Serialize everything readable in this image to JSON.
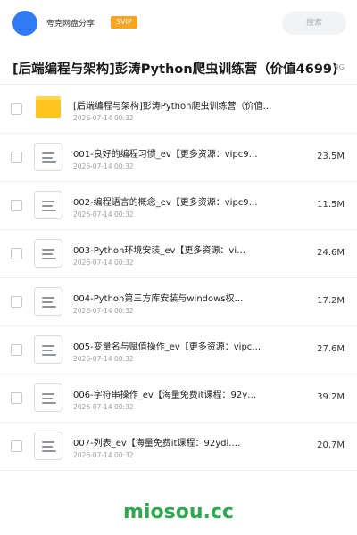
{
  "header": {
    "app_name": "夸克网盘分享",
    "badge": "SVIP",
    "search_placeholder": "搜索"
  },
  "folder": {
    "title": "[后端编程与架构]彭涛Python爬虫训练营（价值4699)",
    "total_size": "9G"
  },
  "files": [
    {
      "name": "[后端编程与架构]彭涛Python爬虫训练营（价值…",
      "date": "2026-07-14 00:32",
      "size": "",
      "type": "folder"
    },
    {
      "name": "001-良好的编程习惯_ev【更多资源：vipc9…",
      "date": "2026-07-14 00:32",
      "size": "23.5M",
      "type": "file"
    },
    {
      "name": "002-编程语言的概念_ev【更多资源：vipc9…",
      "date": "2026-07-14 00:32",
      "size": "11.5M",
      "type": "file"
    },
    {
      "name": "003-Python环境安装_ev【更多资源：vi…",
      "date": "2026-07-14 00:32",
      "size": "24.6M",
      "type": "file"
    },
    {
      "name": "004-Python第三方库安装与windows权…",
      "date": "2026-07-14 00:32",
      "size": "17.2M",
      "type": "file"
    },
    {
      "name": "005-变量名与赋值操作_ev【更多资源：vipc…",
      "date": "2026-07-14 00:32",
      "size": "27.6M",
      "type": "file"
    },
    {
      "name": "006-字符串操作_ev【海量免费it课程：92y…",
      "date": "2026-07-14 00:32",
      "size": "39.2M",
      "type": "file"
    },
    {
      "name": "007-列表_ev【海量免费it课程：92ydl.…",
      "date": "2026-07-14 00:32",
      "size": "20.7M",
      "type": "file"
    }
  ],
  "watermark": "miosou.cc"
}
